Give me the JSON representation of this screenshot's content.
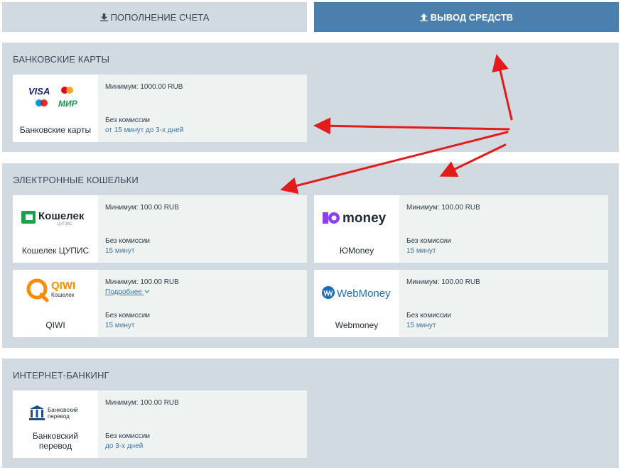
{
  "tabs": {
    "deposit_label": "ПОПОЛНЕНИЕ СЧЕТА",
    "withdraw_label": "ВЫВОД СРЕДСТВ"
  },
  "sections": {
    "cards": {
      "title": "БАНКОВСКИЕ КАРТЫ",
      "items": [
        {
          "name": "Банковские карты",
          "min": "Минимум: 1000.00 RUB",
          "fee": "Без комиссии",
          "time": "от 15 минут до 3-х дней",
          "logo_text": {
            "visa": "VISA",
            "mir": "МИР"
          }
        }
      ]
    },
    "wallets": {
      "title": "ЭЛЕКТРОННЫЕ КОШЕЛЬКИ",
      "items": [
        {
          "name": "Кошелек ЦУПИС",
          "min": "Минимум: 100.00 RUB",
          "fee": "Без комиссии",
          "time": "15 минут",
          "logo_text": {
            "main": "Кошелек",
            "sub": "ЦУПИС"
          }
        },
        {
          "name": "ЮMoney",
          "min": "Минимум: 100.00 RUB",
          "fee": "Без комиссии",
          "time": "15 минут",
          "logo_text": {
            "main": "money"
          }
        },
        {
          "name": "QIWI",
          "min": "Минимум: 100.00 RUB",
          "more": "Подробнее",
          "fee": "Без комиссии",
          "time": "15 минут",
          "logo_text": {
            "main": "QIWI",
            "sub": "Кошелек"
          }
        },
        {
          "name": "Webmoney",
          "min": "Минимум: 100.00 RUB",
          "fee": "Без комиссии",
          "time": "15 минут",
          "logo_text": {
            "main": "WebMoney"
          }
        }
      ]
    },
    "banking": {
      "title": "ИНТЕРНЕТ-БАНКИНГ",
      "items": [
        {
          "name": "Банковский перевод",
          "min": "Минимум: 100.00 RUB",
          "fee": "Без комиссии",
          "time": "до 3-х дней",
          "logo_text": {
            "line1": "Банковский",
            "line2": "перевод"
          }
        }
      ]
    }
  },
  "colors": {
    "accent_tab": "#4b7fad",
    "section_bg": "#d1d9e1",
    "card_bg": "#eef3f2",
    "link": "#3f74a8",
    "annotation_arrow": "#e31b1b"
  }
}
